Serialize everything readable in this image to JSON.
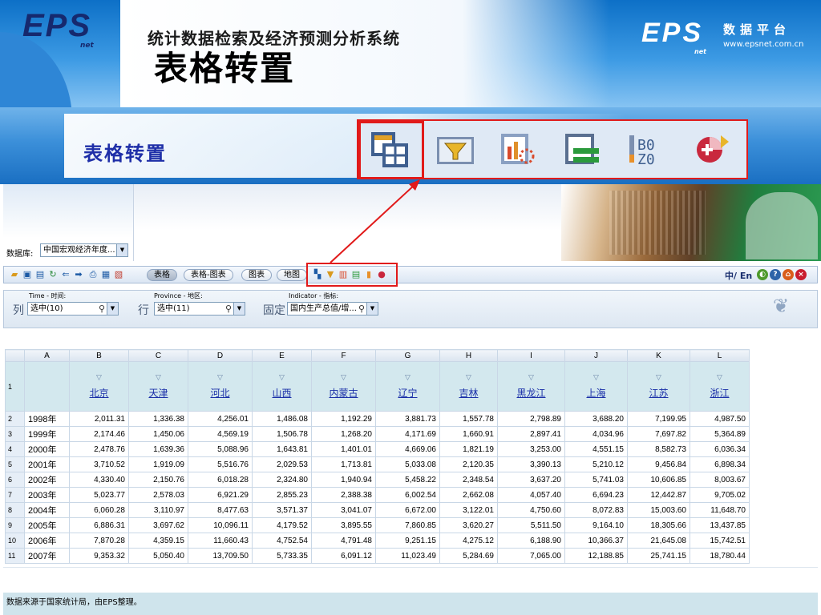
{
  "slide": {
    "title": "表格转置",
    "subtitle": "表格转置",
    "brand": {
      "mark": "EPS",
      "net": "net",
      "cn": "数据平台",
      "url": "www.epsnet.com.cn"
    }
  },
  "big_toolbar": {
    "icons": [
      "table-transpose-icon",
      "filter-table-icon",
      "chart-calc-icon",
      "sort-rows-icon",
      "layout-icon",
      "pie-add-icon"
    ],
    "highlighted": "table-transpose-icon"
  },
  "app": {
    "logo": "EPS",
    "logo_net": "net",
    "title": "统计数据检索及经济预测分析系统",
    "database_label": "数据库:",
    "database_value": "中国宏观经济年度...",
    "tabs": [
      "表格",
      "表格-图表",
      "图表",
      "地图"
    ],
    "active_tab": "表格",
    "lang": "中/ En",
    "filters": {
      "col_caption": "Time - 时间:",
      "col_label": "列",
      "col_value": "选中(10)",
      "row_caption": "Province - 地区:",
      "row_label": "行",
      "row_value": "选中(11)",
      "fixed_caption": "Indicator - 指标:",
      "fixed_label": "固定",
      "fixed_value": "国内生产总值/增..."
    }
  },
  "table": {
    "column_letters": [
      "A",
      "B",
      "C",
      "D",
      "E",
      "F",
      "G",
      "H",
      "I",
      "J",
      "K",
      "L"
    ],
    "provinces": [
      "北京",
      "天津",
      "河北",
      "山西",
      "内蒙古",
      "辽宁",
      "吉林",
      "黑龙江",
      "上海",
      "江苏",
      "浙江"
    ],
    "rows": [
      {
        "n": "2",
        "year": "1998年",
        "values": [
          "2,011.31",
          "1,336.38",
          "4,256.01",
          "1,486.08",
          "1,192.29",
          "3,881.73",
          "1,557.78",
          "2,798.89",
          "3,688.20",
          "7,199.95",
          "4,987.50"
        ]
      },
      {
        "n": "3",
        "year": "1999年",
        "values": [
          "2,174.46",
          "1,450.06",
          "4,569.19",
          "1,506.78",
          "1,268.20",
          "4,171.69",
          "1,660.91",
          "2,897.41",
          "4,034.96",
          "7,697.82",
          "5,364.89"
        ]
      },
      {
        "n": "4",
        "year": "2000年",
        "values": [
          "2,478.76",
          "1,639.36",
          "5,088.96",
          "1,643.81",
          "1,401.01",
          "4,669.06",
          "1,821.19",
          "3,253.00",
          "4,551.15",
          "8,582.73",
          "6,036.34"
        ]
      },
      {
        "n": "5",
        "year": "2001年",
        "values": [
          "3,710.52",
          "1,919.09",
          "5,516.76",
          "2,029.53",
          "1,713.81",
          "5,033.08",
          "2,120.35",
          "3,390.13",
          "5,210.12",
          "9,456.84",
          "6,898.34"
        ]
      },
      {
        "n": "6",
        "year": "2002年",
        "values": [
          "4,330.40",
          "2,150.76",
          "6,018.28",
          "2,324.80",
          "1,940.94",
          "5,458.22",
          "2,348.54",
          "3,637.20",
          "5,741.03",
          "10,606.85",
          "8,003.67"
        ]
      },
      {
        "n": "7",
        "year": "2003年",
        "values": [
          "5,023.77",
          "2,578.03",
          "6,921.29",
          "2,855.23",
          "2,388.38",
          "6,002.54",
          "2,662.08",
          "4,057.40",
          "6,694.23",
          "12,442.87",
          "9,705.02"
        ]
      },
      {
        "n": "8",
        "year": "2004年",
        "values": [
          "6,060.28",
          "3,110.97",
          "8,477.63",
          "3,571.37",
          "3,041.07",
          "6,672.00",
          "3,122.01",
          "4,750.60",
          "8,072.83",
          "15,003.60",
          "11,648.70"
        ]
      },
      {
        "n": "9",
        "year": "2005年",
        "values": [
          "6,886.31",
          "3,697.62",
          "10,096.11",
          "4,179.52",
          "3,895.55",
          "7,860.85",
          "3,620.27",
          "5,511.50",
          "9,164.10",
          "18,305.66",
          "13,437.85"
        ]
      },
      {
        "n": "10",
        "year": "2006年",
        "values": [
          "7,870.28",
          "4,359.15",
          "11,660.43",
          "4,752.54",
          "4,791.48",
          "9,251.15",
          "4,275.12",
          "6,188.90",
          "10,366.37",
          "21,645.08",
          "15,742.51"
        ]
      },
      {
        "n": "11",
        "year": "2007年",
        "values": [
          "9,353.32",
          "5,050.40",
          "13,709.50",
          "5,733.35",
          "6,091.12",
          "11,023.49",
          "5,284.69",
          "7,065.00",
          "12,188.85",
          "25,741.15",
          "18,780.44"
        ]
      }
    ]
  },
  "footer": {
    "source": "数据来源于国家统计局，由EPS整理。"
  },
  "colors": {
    "highlight": "#e11a1a",
    "link": "#1a2fa8",
    "header_band": "#d3e8ee"
  }
}
